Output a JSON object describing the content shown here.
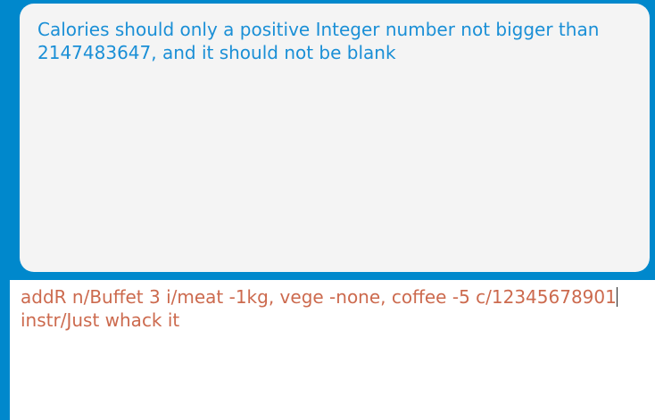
{
  "result_display": {
    "line1": "Calories should only a positive Integer number not bigger than",
    "line2": "2147483647, and it should not be blank"
  },
  "command_box": {
    "line1": "addR n/Buffet 3 i/meat -1kg, vege -none, coffee -5 c/12345678901",
    "line2": "instr/Just whack it"
  },
  "colors": {
    "background": "#0088cc",
    "result_panel": "#f4f4f4",
    "result_text": "#1a8fd6",
    "command_text": "#cc6a4e"
  }
}
